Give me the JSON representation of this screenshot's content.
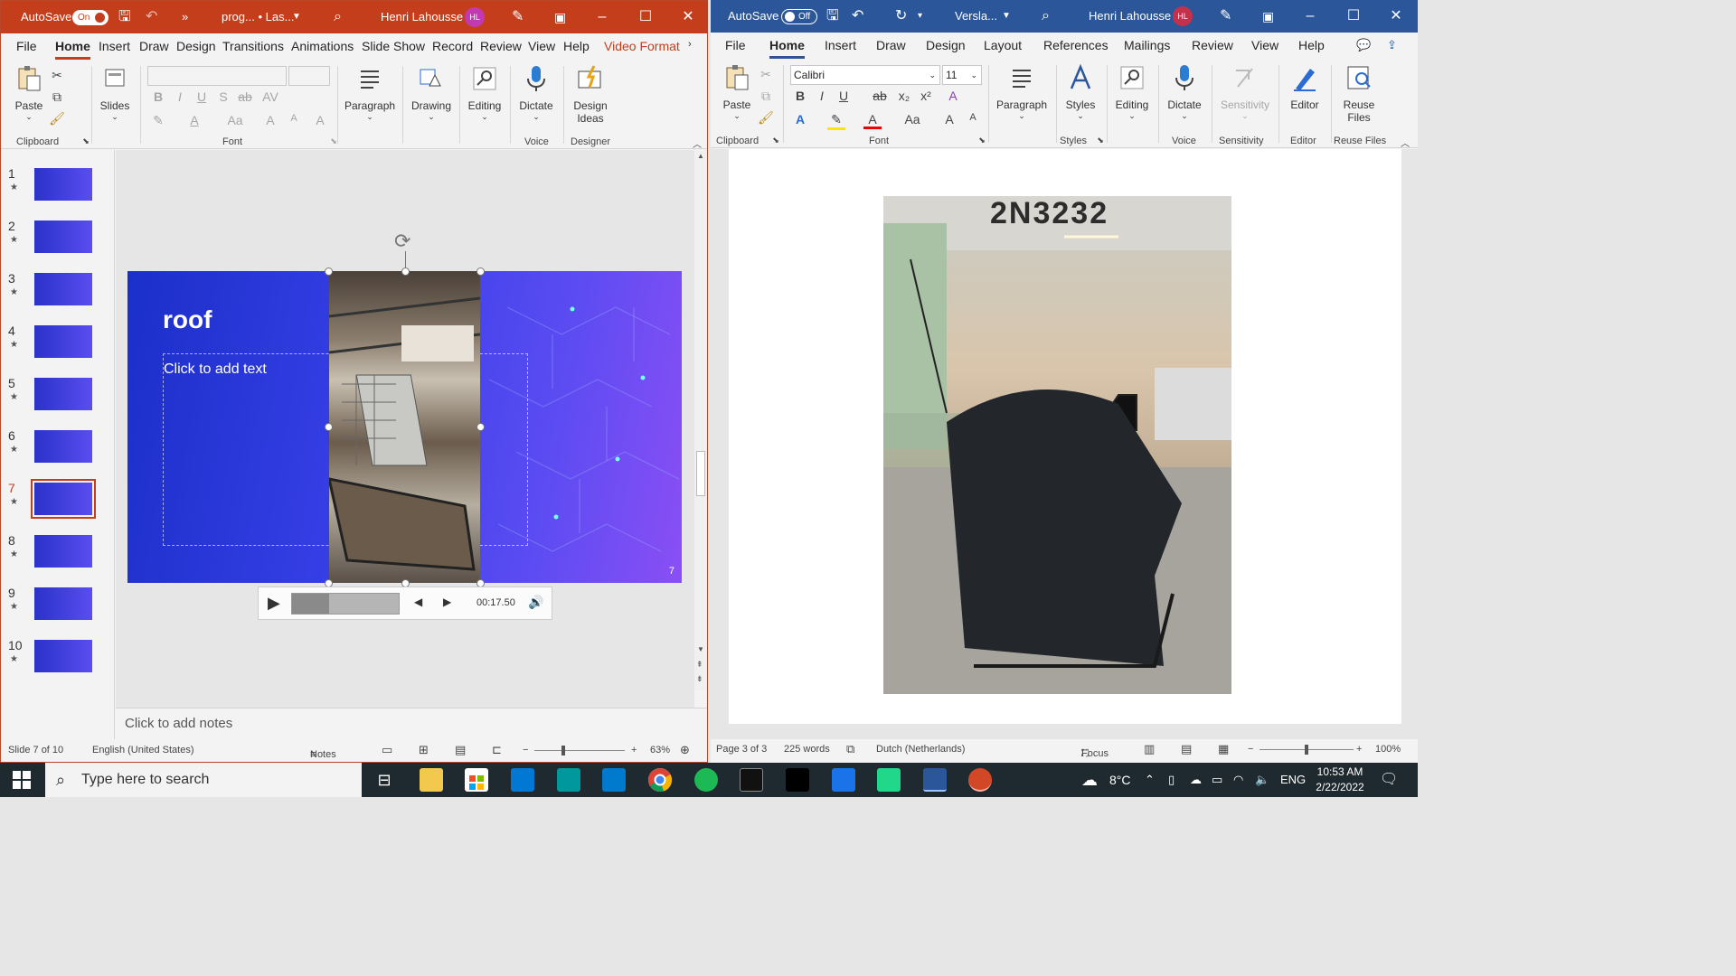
{
  "ppt": {
    "autosave_label": "AutoSave",
    "autosave_state": "On",
    "doc_title": "prog... • Las...",
    "user_name": "Henri Lahousse",
    "user_initials": "HL",
    "menus": [
      "File",
      "Home",
      "Insert",
      "Draw",
      "Design",
      "Transitions",
      "Animations",
      "Slide Show",
      "Record",
      "Review",
      "View",
      "Help",
      "Video Format"
    ],
    "active_menu": "Home",
    "ribbon": {
      "paste": "Paste",
      "clipboard": "Clipboard",
      "slides": "Slides",
      "font_group": "Font",
      "paragraph": "Paragraph",
      "drawing": "Drawing",
      "editing": "Editing",
      "dictate": "Dictate",
      "voice": "Voice",
      "design_ideas_1": "Design",
      "design_ideas_2": "Ideas",
      "designer": "Designer",
      "font_buttons": [
        "B",
        "I",
        "U",
        "S",
        "ab",
        "AV"
      ],
      "case_label": "Aa"
    },
    "thumbnails": [
      {
        "num": "1",
        "star": "★"
      },
      {
        "num": "2",
        "star": "★"
      },
      {
        "num": "3",
        "star": "★"
      },
      {
        "num": "4",
        "star": "★"
      },
      {
        "num": "5",
        "star": "★"
      },
      {
        "num": "6",
        "star": "★"
      },
      {
        "num": "7",
        "star": "★"
      },
      {
        "num": "8",
        "star": "★"
      },
      {
        "num": "9",
        "star": "★"
      },
      {
        "num": "10",
        "star": "★"
      }
    ],
    "selected_slide": "7",
    "slide": {
      "title": "roof",
      "placeholder": "Click to add text",
      "number": "7"
    },
    "video": {
      "time": "00:17.50",
      "progress": 0.35
    },
    "notes_placeholder": "Click to add notes",
    "status": {
      "slide_of": "Slide 7 of 10",
      "language": "English (United States)",
      "notes": "Notes",
      "zoom": "63%"
    }
  },
  "word": {
    "autosave_label": "AutoSave",
    "autosave_state": "Off",
    "doc_title": "Versla...",
    "user_name": "Henri Lahousse",
    "user_initials": "HL",
    "menus": [
      "File",
      "Home",
      "Insert",
      "Draw",
      "Design",
      "Layout",
      "References",
      "Mailings",
      "Review",
      "View",
      "Help"
    ],
    "active_menu": "Home",
    "ribbon": {
      "paste": "Paste",
      "clipboard": "Clipboard",
      "font_name": "Calibri",
      "font_size": "11",
      "font_group": "Font",
      "paragraph": "Paragraph",
      "styles": "Styles",
      "editing": "Editing",
      "dictate": "Dictate",
      "voice": "Voice",
      "sensitivity": "Sensitivity",
      "editor": "Editor",
      "reuse_1": "Reuse",
      "reuse_2": "Files",
      "reuse_files": "Reuse Files",
      "font_buttons": [
        "B",
        "I",
        "U",
        "ab",
        "x₂",
        "x²"
      ],
      "case_label": "Aa"
    },
    "photo_text": "2N3232",
    "status": {
      "page_of": "Page 3 of 3",
      "words": "225 words",
      "language": "Dutch (Netherlands)",
      "focus": "Focus",
      "zoom": "100%"
    }
  },
  "taskbar": {
    "search_placeholder": "Type here to search",
    "weather": "8°C",
    "language": "ENG",
    "time": "10:53 AM",
    "date": "2/22/2022",
    "apps": [
      "task-view",
      "file-explorer",
      "store",
      "mail",
      "arduino",
      "vscode",
      "chrome",
      "spotify",
      "terminal",
      "remarkable",
      "vmware",
      "pycharm",
      "word",
      "powerpoint"
    ]
  },
  "colors": {
    "ppt_accent": "#c43e1c",
    "word_accent": "#2b579a",
    "slide_blue": "#2a34d8"
  }
}
